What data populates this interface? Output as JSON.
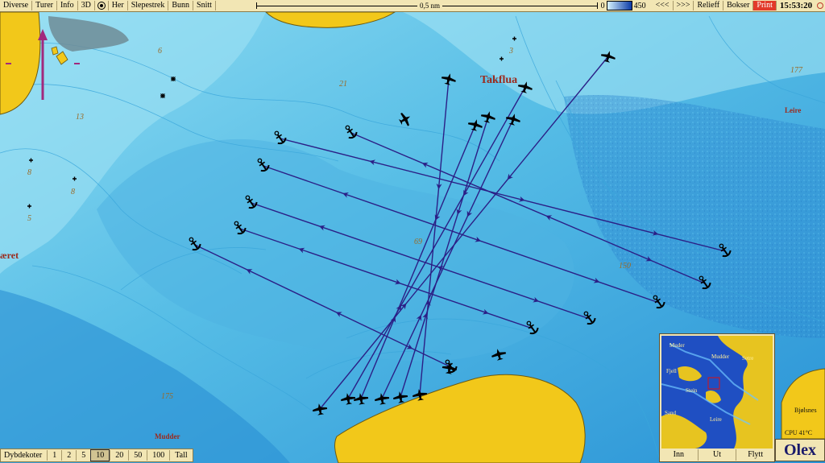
{
  "toolbar": {
    "menus": [
      "Diverse",
      "Turer",
      "Info",
      "3D"
    ],
    "menus2": [
      "Her",
      "Slepestrek",
      "Bunn",
      "Snitt"
    ],
    "scale_label": "0,5 nm",
    "depth_min": "0",
    "depth_max": "450",
    "back_label": "<<<",
    "forward_label": ">>>",
    "relief_label": "Relieff",
    "boxes_label": "Bokser",
    "print_label": "Print",
    "time": "15:53:20"
  },
  "places": {
    "takflua": "Takflua",
    "leire": "Leire",
    "mudder": "Mudder",
    "aeret": "æret"
  },
  "depths": [
    "6",
    "21",
    "13",
    "3",
    "177",
    "8",
    "8",
    "5",
    "69",
    "150",
    "175"
  ],
  "dybdekoter": {
    "title": "Dybdekoter",
    "options": [
      "1",
      "2",
      "5",
      "10",
      "20",
      "50",
      "100",
      "Tall"
    ],
    "selected": "10"
  },
  "overview": {
    "labels": [
      "Muder",
      "Fjell",
      "Stein",
      "Sand",
      "Setre",
      "Leire",
      "Mudder"
    ],
    "buttons": [
      "Inn",
      "Ut",
      "Flytt"
    ]
  },
  "status": {
    "cpu": "CPU 41°C",
    "bjolsnes": "Bjølsnes",
    "logo": "Olex"
  },
  "colors": {
    "land": "#f2c81a",
    "track": "#2b1f86",
    "deep": "#1f8bd0",
    "shallow": "#8fdcf2"
  },
  "icons": [
    "anchor-icon",
    "plane-icon",
    "waypoint-cross-icon",
    "compass-arrow-icon",
    "target-icon",
    "sun-icon"
  ]
}
